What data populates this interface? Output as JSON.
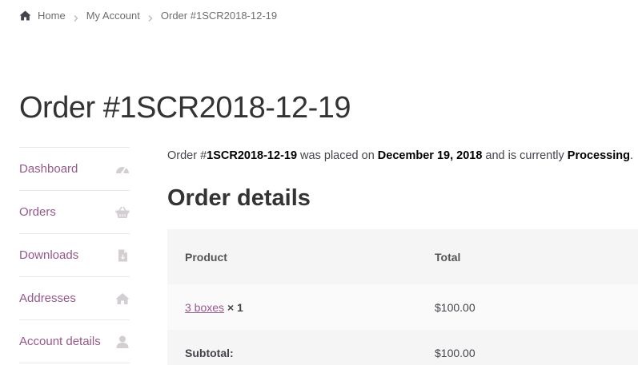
{
  "breadcrumb": {
    "home": "Home",
    "my_account": "My Account",
    "current": "Order #1SCR2018-12-19"
  },
  "page": {
    "title": "Order #1SCR2018-12-19"
  },
  "navigation": {
    "items": [
      {
        "label": "Dashboard",
        "icon": "dashboard-gauge-icon"
      },
      {
        "label": "Orders",
        "icon": "basket-icon"
      },
      {
        "label": "Downloads",
        "icon": "file-icon"
      },
      {
        "label": "Addresses",
        "icon": "home-icon"
      },
      {
        "label": "Account details",
        "icon": "user-icon"
      }
    ]
  },
  "order": {
    "intro_prefix": "Order #",
    "number": "1SCR2018-12-19",
    "intro_placed": " was placed on ",
    "date": "December 19, 2018",
    "intro_status": " and is currently ",
    "status": "Processing",
    "intro_end": "."
  },
  "details": {
    "title": "Order details",
    "columns": {
      "product": "Product",
      "total": "Total"
    },
    "items": [
      {
        "product": "3 boxes",
        "qty": "× 1",
        "total": "$100.00"
      }
    ],
    "subtotal_label": "Subtotal:",
    "subtotal_value": "$100.00"
  },
  "colors": {
    "link": "#96588a",
    "text": "#43454b",
    "icon": "#d3ced2",
    "table_head_bg": "#f5f5f5",
    "table_row_bg": "#fafafa"
  }
}
